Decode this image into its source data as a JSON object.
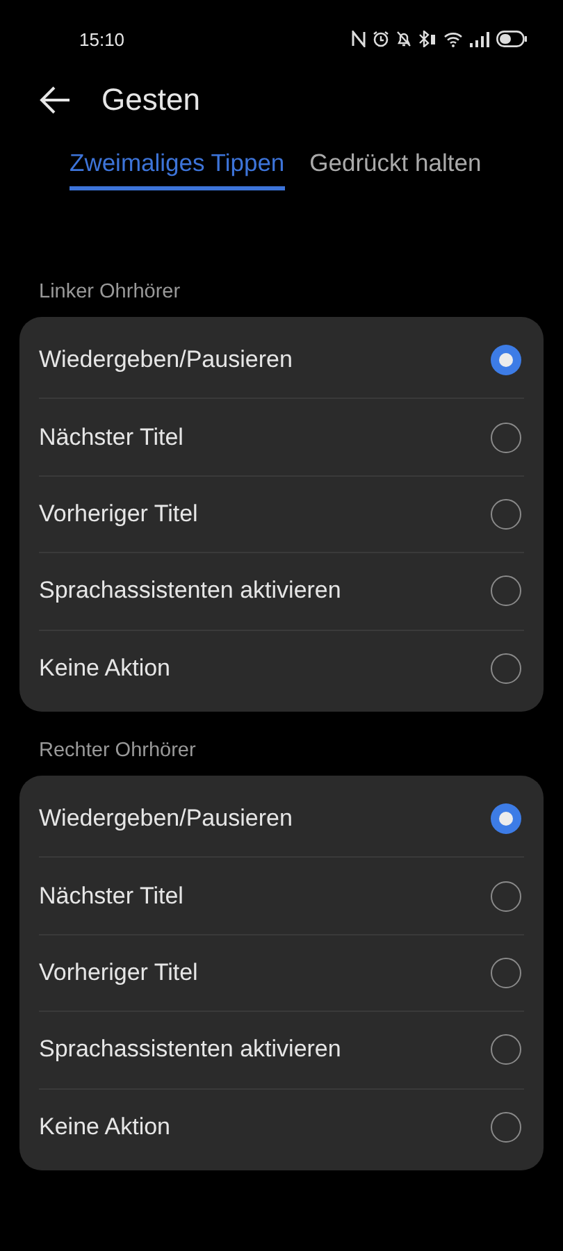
{
  "status_bar": {
    "time": "15:10"
  },
  "header": {
    "title": "Gesten"
  },
  "tabs": [
    {
      "label": "Zweimaliges Tippen",
      "selected": true
    },
    {
      "label": "Gedrückt halten",
      "selected": false
    }
  ],
  "sections": [
    {
      "title": "Linker Ohrhörer",
      "options": [
        {
          "label": "Wiedergeben/Pausieren",
          "selected": true
        },
        {
          "label": "Nächster Titel",
          "selected": false
        },
        {
          "label": "Vorheriger Titel",
          "selected": false
        },
        {
          "label": "Sprachassistenten aktivieren",
          "selected": false
        },
        {
          "label": "Keine Aktion",
          "selected": false
        }
      ]
    },
    {
      "title": "Rechter Ohrhörer",
      "options": [
        {
          "label": "Wiedergeben/Pausieren",
          "selected": true
        },
        {
          "label": "Nächster Titel",
          "selected": false
        },
        {
          "label": "Vorheriger Titel",
          "selected": false
        },
        {
          "label": "Sprachassistenten aktivieren",
          "selected": false
        },
        {
          "label": "Keine Aktion",
          "selected": false
        }
      ]
    }
  ]
}
